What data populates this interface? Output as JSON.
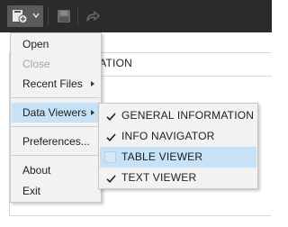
{
  "toolbar": {
    "icons": [
      "add-icon",
      "chevron-down-icon",
      "save-icon",
      "share-icon"
    ]
  },
  "background": {
    "header_text": "MATION"
  },
  "menu": {
    "items": [
      {
        "label": "Open",
        "enabled": true
      },
      {
        "label": "Close",
        "enabled": false
      },
      {
        "label": "Recent Files",
        "enabled": true,
        "has_submenu": true
      },
      {
        "label": "Data Viewers",
        "enabled": true,
        "has_submenu": true,
        "active": true
      },
      {
        "label": "Preferences...",
        "enabled": true
      },
      {
        "label": "About",
        "enabled": true
      },
      {
        "label": "Exit",
        "enabled": true
      }
    ]
  },
  "submenu": {
    "items": [
      {
        "label": "GENERAL INFORMATION",
        "checked": true
      },
      {
        "label": "INFO NAVIGATOR",
        "checked": true
      },
      {
        "label": "TABLE VIEWER",
        "checked": false,
        "hovered": true
      },
      {
        "label": "TEXT VIEWER",
        "checked": true
      }
    ]
  },
  "colors": {
    "toolbar_bg": "#2b2b2b",
    "menu_bg": "#f2f2f2",
    "highlight": "#c7e2f7",
    "disabled_text": "#a5a5a5"
  }
}
